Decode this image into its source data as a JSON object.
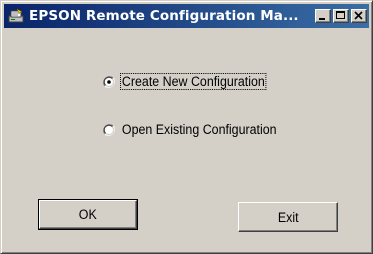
{
  "window": {
    "title": "EPSON Remote Configuration Ma...",
    "icon": "epson-app-icon",
    "caption_buttons": [
      "minimize",
      "maximize",
      "close"
    ]
  },
  "options": {
    "selected": "create",
    "create_label": "Create New Configuration",
    "open_label": "Open Existing Configuration"
  },
  "buttons": {
    "ok_label": "OK",
    "exit_label": "Exit"
  },
  "colors": {
    "face": "#d4d0c8",
    "titlebar_start": "#0a246a",
    "titlebar_end": "#3a6ea5"
  }
}
